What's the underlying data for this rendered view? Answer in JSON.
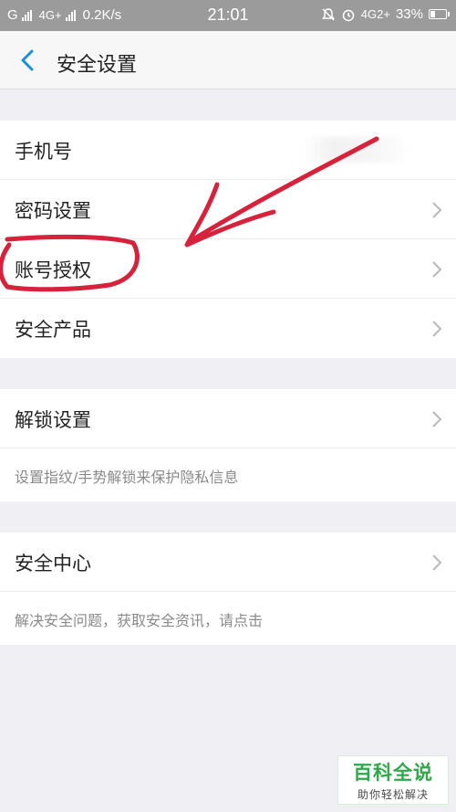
{
  "status_bar": {
    "carrier1": "G",
    "network": "4G+",
    "speed": "0.2K/s",
    "time": "21:01",
    "network_right": "4G2+",
    "battery": "33%",
    "battery_level": 0.33,
    "icons": [
      "mute-icon",
      "alarm-icon",
      "battery-icon"
    ]
  },
  "nav": {
    "back_icon": "chevron-left-icon",
    "title": "安全设置"
  },
  "groups": [
    {
      "rows": [
        {
          "label": "手机号",
          "has_chevron": false
        },
        {
          "label": "密码设置",
          "has_chevron": true
        },
        {
          "label": "账号授权",
          "has_chevron": true
        },
        {
          "label": "安全产品",
          "has_chevron": true
        }
      ]
    },
    {
      "rows": [
        {
          "label": "解锁设置",
          "has_chevron": true
        }
      ],
      "hint": "设置指纹/手势解锁来保护隐私信息"
    },
    {
      "rows": [
        {
          "label": "安全中心",
          "has_chevron": true
        }
      ],
      "hint": "解决安全问题，获取安全资讯，请点击"
    }
  ],
  "watermark": {
    "title": "百科全说",
    "subtitle": "助你轻松解决"
  },
  "colors": {
    "accent": "#1a8fd6",
    "annotation": "#d6223a",
    "watermark_green": "#2fa84a"
  }
}
